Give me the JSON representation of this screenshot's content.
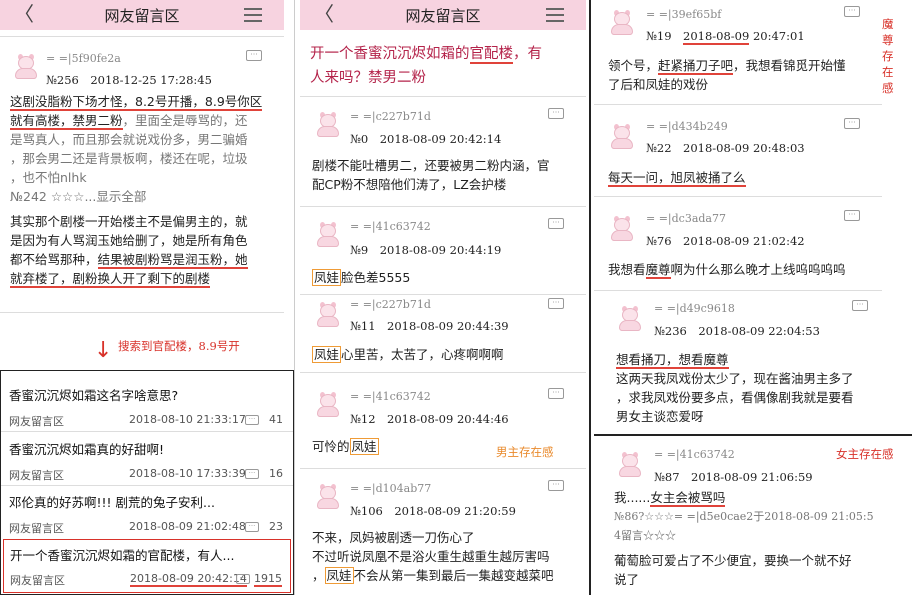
{
  "nav_title": "网友留言区",
  "p1": {
    "post": {
      "uid": "= =|5f90fe2a",
      "meta": "№256　2018-12-25 17:28:45",
      "l1a": "这剧没脂粉下场才怪，8.2号开播，",
      "l1b": "8.9号你区",
      "l2a": "就有高楼，禁男二粉",
      "l2b": "，里面全是辱骂的，还",
      "l3": "是骂真人，而且那会就说戏份多，男二骗婚",
      "l4": "，那会男二还是背景板啊，楼还在呢，垃圾",
      "l5": "，也不怕nlhk",
      "quote": "№242 ☆☆☆...显示全部",
      "b1": "其实那个剧楼一开始楼主不是偏男主的，就",
      "b2": "是因为有人骂润玉她给删了，她是所有角色",
      "b3a": "都不给骂那种，",
      "b3b": "结果被剧粉骂是润玉粉，她",
      "b4a": "就弃楼了，剧粉换人开了剩下的剧楼"
    },
    "annotation": "搜索到官配楼，8.9号开",
    "arrow": "↓",
    "list": [
      {
        "title": "香蜜沉沉烬如霜这名字啥意思?",
        "board": "网友留言区",
        "date": "2018-08-10 21:33:17",
        "count": "41"
      },
      {
        "title": "香蜜沉沉烬如霜真的好甜啊!",
        "board": "网友留言区",
        "date": "2018-08-10 17:33:39",
        "count": "16"
      },
      {
        "title": "邓伦真的好苏啊!!! 剧荒的兔子安利...",
        "board": "网友留言区",
        "date": "2018-08-09 21:02:48",
        "count": "23"
      },
      {
        "title": "开一个香蜜沉沉烬如霜的官配楼，有人...",
        "board": "网友留言区",
        "date": "2018-08-09 20:42:14",
        "count": "1915"
      }
    ]
  },
  "p2": {
    "thread_title_a": "开一个香蜜沉沉烬如霜的",
    "thread_title_b": "官配楼",
    "thread_title_c": "，有",
    "thread_title_d": "人来吗？禁男二粉",
    "posts": [
      {
        "uid": "= =|c227b71d",
        "meta": "№0　2018-08-09 20:42:14"
      },
      {
        "uid": "= =|41c63742",
        "meta": "№9　2018-08-09 20:44:19"
      },
      {
        "uid": "= =|c227b71d",
        "meta": "№11　2018-08-09 20:44:39"
      },
      {
        "uid": "= =|41c63742",
        "meta": "№12　2018-08-09 20:44:46"
      },
      {
        "uid": "= =|d104ab77",
        "meta": "№106　2018-08-09 21:20:59"
      }
    ],
    "t0a": "剧楼不能吐槽男二，还要被男二粉内涵，官",
    "t0b": "配CP粉不想陪他们涛了，LZ会护楼",
    "t1a": "凤娃",
    "t1b": "脸色差5555",
    "t2a": "凤娃",
    "t2b": "心里苦，太苦了，心疼啊啊啊",
    "t3a": "可怜的",
    "t3b": "凤娃",
    "note": "男主存在感",
    "t4a": "不来，凤妈被剧透一刀伤心了",
    "t4b": "不过听说凤凰不是浴火重生越重生越厉害吗",
    "t4c1": "，",
    "t4c2": "凤娃",
    "t4c3": "不会从第一集到最后一集越变越菜吧"
  },
  "p3": {
    "note_mozun": [
      "魔",
      "尊",
      "存",
      "在",
      "感"
    ],
    "note_nvzhu": "女主存在感",
    "posts": [
      {
        "uid": "= =|39ef65bf",
        "meta_a": "№19　",
        "meta_b": "2018-08-09",
        "meta_c": " 20:47:01"
      },
      {
        "uid": "= =|d434b249",
        "meta": "№22　2018-08-09 20:48:03"
      },
      {
        "uid": "= =|dc3ada77",
        "meta": "№76　2018-08-09 21:02:42"
      },
      {
        "uid": "= =|d49c9618",
        "meta": "№236　2018-08-09 22:04:53"
      },
      {
        "uid": "= =|41c63742",
        "meta": "№87　2018-08-09 21:06:59"
      }
    ],
    "t0a": "领个号，",
    "t0b": "赶紧捅刀子吧",
    "t0c": "，我想看锦觅开始懂",
    "t0d": "了后和凤娃的戏份",
    "t1": "每天一问，旭凤被捅了么",
    "t2a": "我想看",
    "t2b": "魔尊",
    "t2c": "啊为什么那么晚才上线呜呜呜呜",
    "t3a": "想看捅刀，想看魔尊",
    "t3b": "这两天我凤戏份太少了，现在酱油男主多了",
    "t3c": "，求我凤戏份要多点，看偶像剧我就是要看",
    "t3d": "男女主谈恋爱呀",
    "t4a": "我......",
    "t4b": "女主会被骂吗",
    "t4c": "№86?☆☆☆= =|d5e0cae2于2018-08-09 21:05:5",
    "t4d": "4留言☆☆☆",
    "t4e": "葡萄脸可爱占了不少便宜，要换一个就不好",
    "t4f": "说了"
  }
}
